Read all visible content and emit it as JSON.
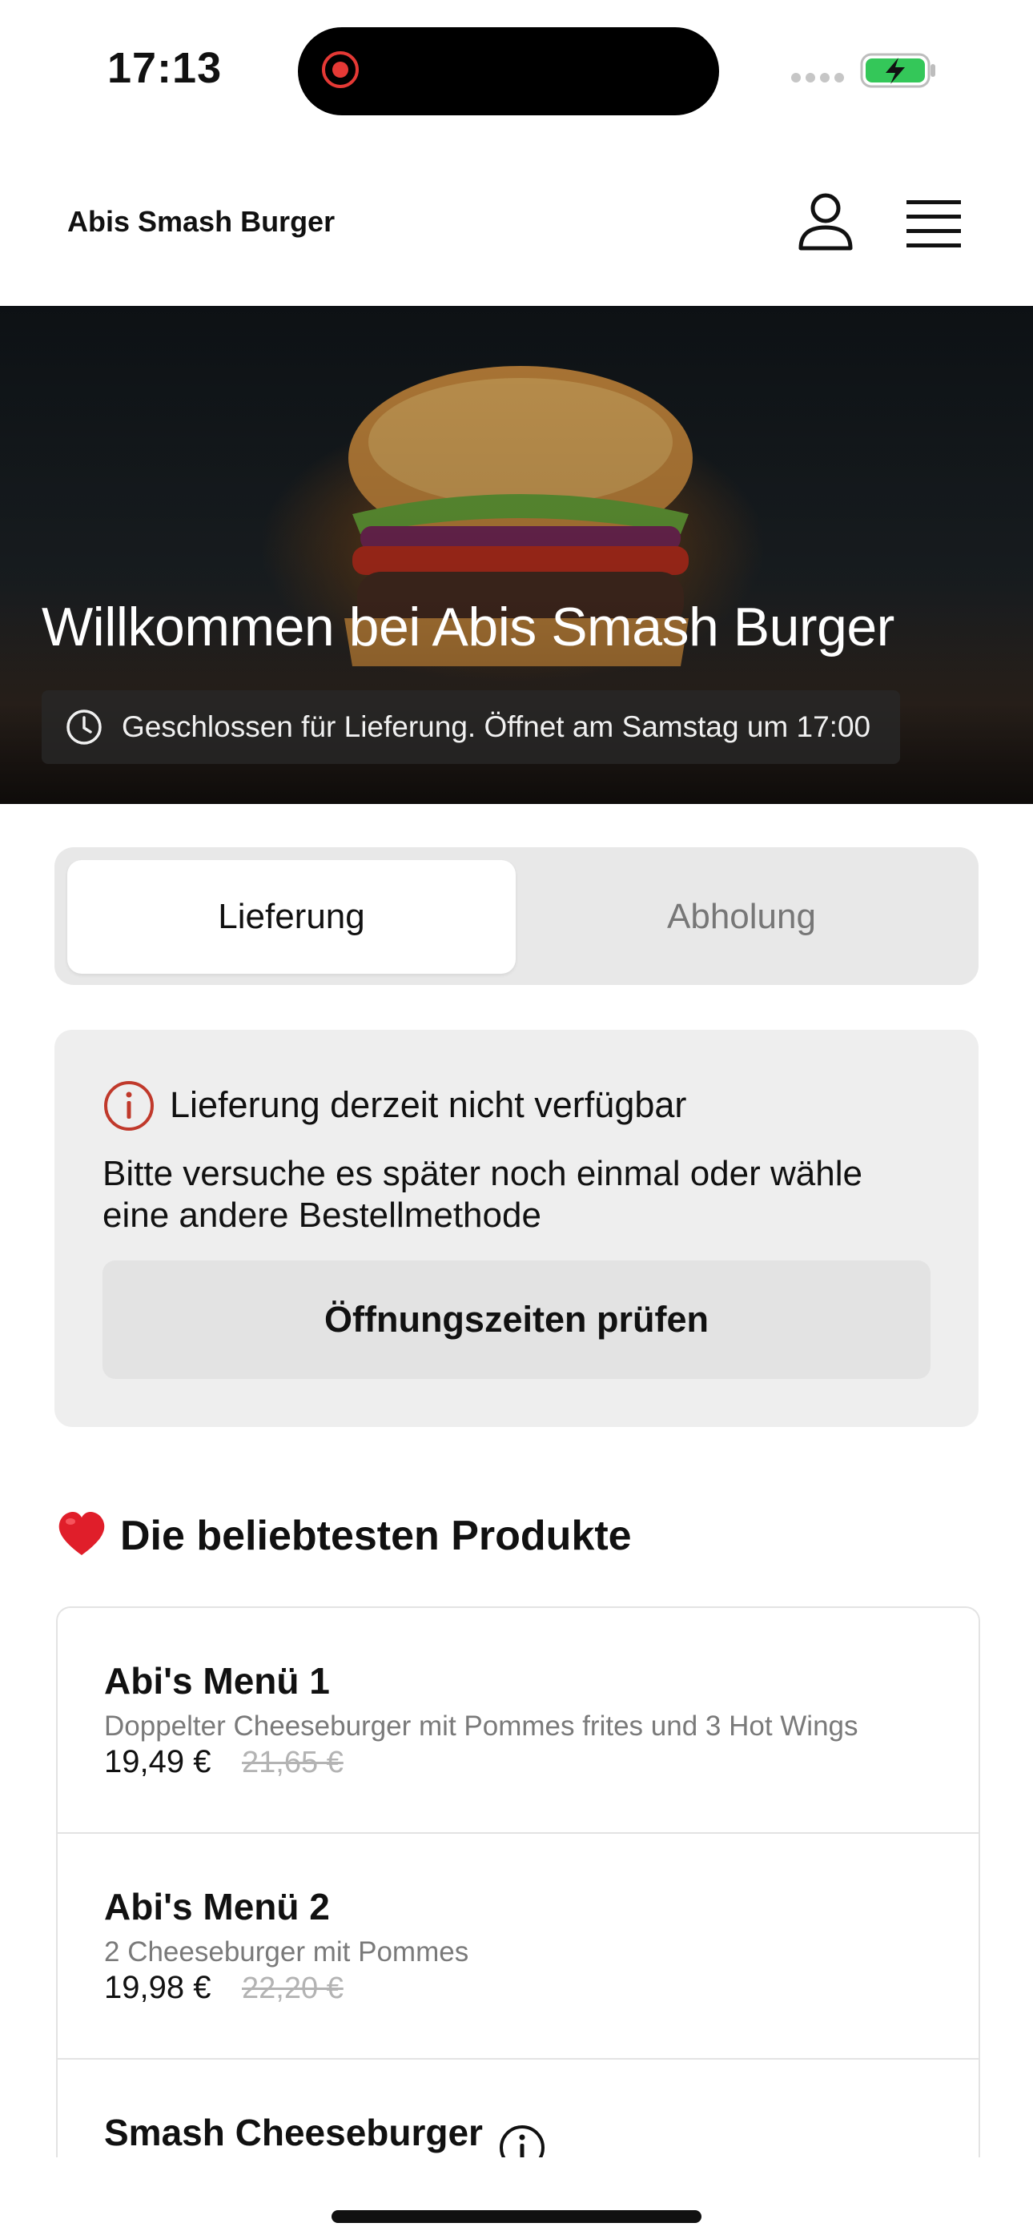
{
  "status_bar": {
    "time": "17:13"
  },
  "header": {
    "title": "Abis Smash Burger"
  },
  "hero": {
    "title": "Willkommen bei Abis Smash Burger",
    "status": "Geschlossen für Lieferung. Öffnet am Samstag um 17:00"
  },
  "order_mode": {
    "tabs": [
      "Lieferung",
      "Abholung"
    ],
    "selected": "Lieferung"
  },
  "notice": {
    "title": "Lieferung derzeit nicht verfügbar",
    "text": "Bitte versuche es später noch einmal oder wähle eine andere Bestellmethode",
    "button": "Öffnungszeiten prüfen"
  },
  "popular": {
    "title": "Die beliebtesten Produkte",
    "products": [
      {
        "name": "Abi's Menü 1",
        "description": "Doppelter Cheeseburger mit Pommes frites und 3 Hot Wings",
        "price": "19,49 €",
        "old_price": "21,65 €"
      },
      {
        "name": "Abi's Menü 2",
        "description": "2 Cheeseburger mit Pommes",
        "price": "19,98 €",
        "old_price": "22,20 €"
      },
      {
        "name": "Smash Cheeseburger"
      }
    ]
  },
  "colors": {
    "accent_red": "#c0392b",
    "battery_green": "#34c759"
  }
}
